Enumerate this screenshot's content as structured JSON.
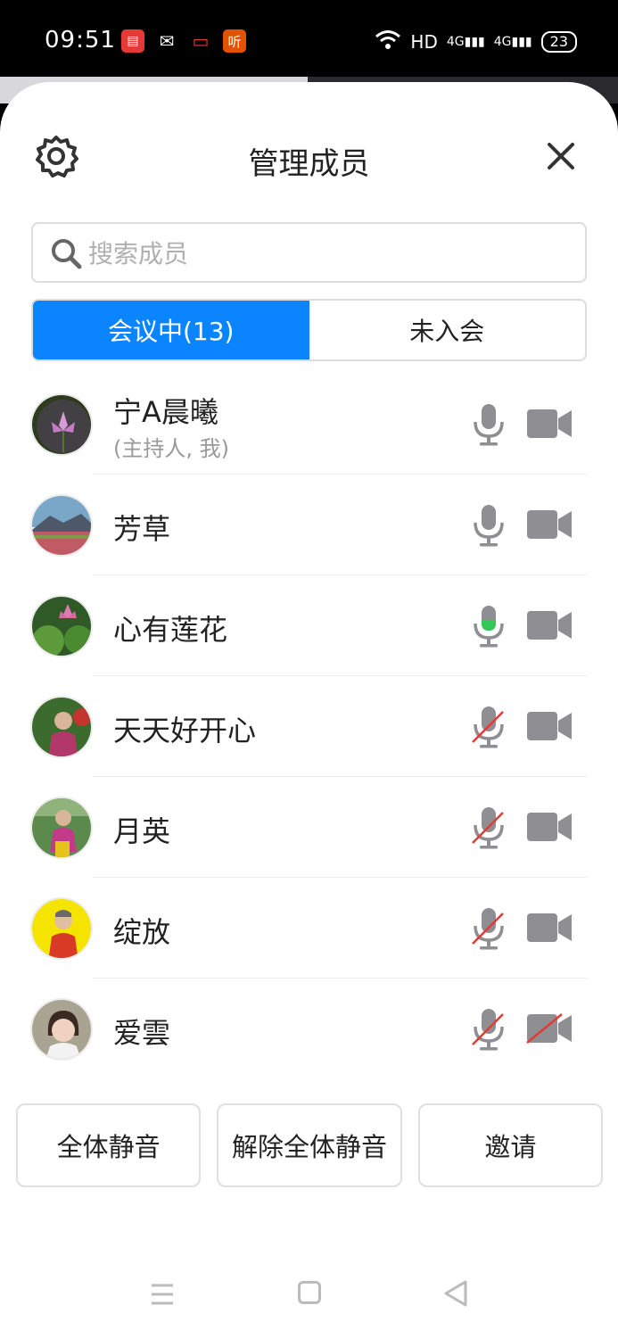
{
  "status_bar": {
    "time": "09:51",
    "app_icons": [
      {
        "name": "news-app-icon",
        "color": "#e53935",
        "glyph": "▤"
      },
      {
        "name": "wechat-icon",
        "color": "#000000",
        "glyph": "💬"
      },
      {
        "name": "screen-record-icon",
        "color": "#e53935",
        "glyph": "▭"
      },
      {
        "name": "listen-app-icon",
        "color": "#e65100",
        "glyph": "听"
      }
    ],
    "network": "HD",
    "signal1": "4G",
    "signal2": "4G",
    "battery": "23"
  },
  "header": {
    "title": "管理成员"
  },
  "search": {
    "placeholder": "搜索成员"
  },
  "tabs": [
    {
      "label": "会议中(13)",
      "active": true
    },
    {
      "label": "未入会",
      "active": false
    }
  ],
  "members": [
    {
      "name": "宁A晨曦",
      "sub": "(主持人, 我)",
      "mic": "on",
      "camera": "on",
      "avatar_color": "#6a4a8a"
    },
    {
      "name": "芳草",
      "sub": "",
      "mic": "on",
      "camera": "on",
      "avatar_color": "#7aa6c8"
    },
    {
      "name": "心有莲花",
      "sub": "",
      "mic": "speaking",
      "camera": "on",
      "avatar_color": "#3f7a35"
    },
    {
      "name": "天天好开心",
      "sub": "",
      "mic": "muted",
      "camera": "on",
      "avatar_color": "#b2386a"
    },
    {
      "name": "月英",
      "sub": "",
      "mic": "muted",
      "camera": "on",
      "avatar_color": "#5c8a4c"
    },
    {
      "name": "绽放",
      "sub": "",
      "mic": "muted",
      "camera": "on",
      "avatar_color": "#f5e400"
    },
    {
      "name": "爱雲",
      "sub": "",
      "mic": "muted",
      "camera": "off",
      "avatar_color": "#a9a392"
    }
  ],
  "actions": {
    "mute_all": "全体静音",
    "unmute_all": "解除全体静音",
    "invite": "邀请"
  },
  "colors": {
    "accent": "#0a84ff",
    "speaking": "#34c759",
    "muted_slash": "#e53935",
    "icon_gray": "#8e8e93"
  }
}
